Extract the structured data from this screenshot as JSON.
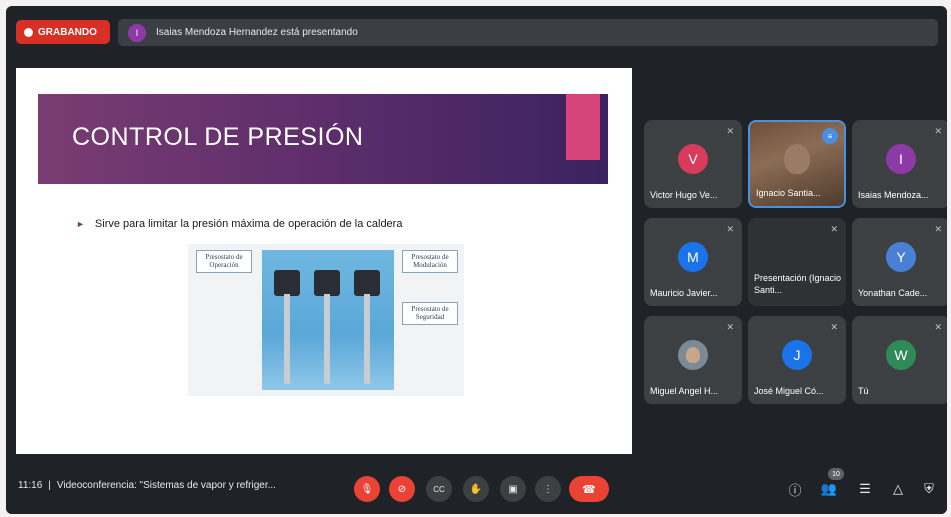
{
  "banner": {
    "recording_label": "GRABANDO",
    "presenter_initial": "I",
    "presenting_text": "Isaias Mendoza Hernandez está presentando"
  },
  "slide": {
    "title": "CONTROL DE PRESIÓN",
    "bullet": "Sirve para limitar la presión máxima de operación de la caldera",
    "labels": {
      "operation": "Presostato de Operación",
      "modulation": "Presostato de Modulación",
      "safety": "Presostato de Seguridad"
    }
  },
  "participants": [
    {
      "initial": "V",
      "name": "Victor Hugo Ve...",
      "color": "#d93b5a"
    },
    {
      "name": "Ignacio Santia..."
    },
    {
      "initial": "I",
      "name": "Isaias Mendoza...",
      "color": "#8e3aa6"
    },
    {
      "initial": "M",
      "name": "Mauricio Javier...",
      "color": "#1a73e8"
    },
    {
      "name": "Presentación (Ignacio Santi..."
    },
    {
      "initial": "Y",
      "name": "Yonathan Cade...",
      "color": "#4a7fd6"
    },
    {
      "name": "Miguel Angel H..."
    },
    {
      "initial": "J",
      "name": "José Miguel Có...",
      "color": "#1a73e8"
    },
    {
      "initial": "W",
      "name": "Tú",
      "color": "#2e8b57"
    }
  ],
  "bottom": {
    "time": "11:16",
    "separator": "|",
    "meeting_title": "Videoconferencia: \"Sistemas de vapor y refriger...",
    "participants_count": "10"
  },
  "icons": {
    "mic_off": "🎙",
    "cam_off": "⊘",
    "captions": "CC",
    "hand": "✋",
    "present": "▣",
    "more": "⋮",
    "end_call": "☎",
    "info": "ⓘ",
    "people": "👥",
    "chat": "☰",
    "activities": "△",
    "host": "⛨",
    "muted": "✕",
    "speaking": "≡"
  },
  "colors": {
    "record": "#d93025",
    "end_call": "#ea4335",
    "active_tile": "#4a90e2"
  }
}
